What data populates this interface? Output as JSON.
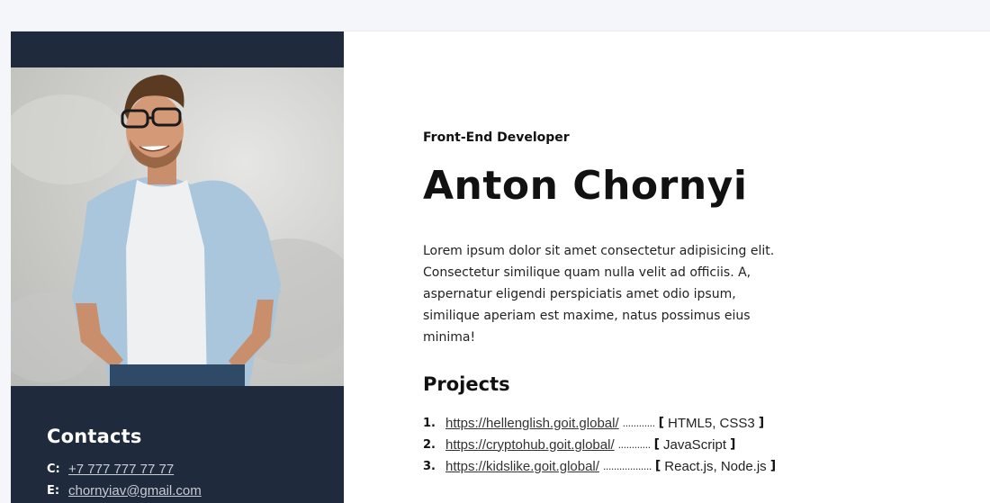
{
  "profile": {
    "role": "Front-End Developer",
    "name": "Anton Chornyi",
    "about": "Lorem ipsum dolor sit amet consectetur adipisicing elit. Consectetur similique quam nulla velit ad officiis. A, aspernatur eligendi perspiciatis amet odio ipsum, similique aperiam est maxime, natus possimus eius minima!"
  },
  "contacts": {
    "title": "Contacts",
    "phone_key": "C:",
    "phone": "+7 777 777 77 77",
    "email_key": "E:",
    "email": "chornyiav@gmail.com"
  },
  "projects": {
    "title": "Projects",
    "items": [
      {
        "num": "1.",
        "url": "https://hellenglish.goit.global/",
        "dots": "............",
        "tech": "HTML5, CSS3"
      },
      {
        "num": "2.",
        "url": "https://cryptohub.goit.global/",
        "dots": "............",
        "tech": "JavaScript"
      },
      {
        "num": "3.",
        "url": "https://kidslike.goit.global/",
        "dots": "..................",
        "tech": "React.js, Node.js"
      }
    ],
    "bracket_open": "[",
    "bracket_close": "]"
  },
  "colors": {
    "sidebar": "#1f2a3c",
    "page_bg": "#f4f6f9",
    "content_bg": "#ffffff"
  }
}
